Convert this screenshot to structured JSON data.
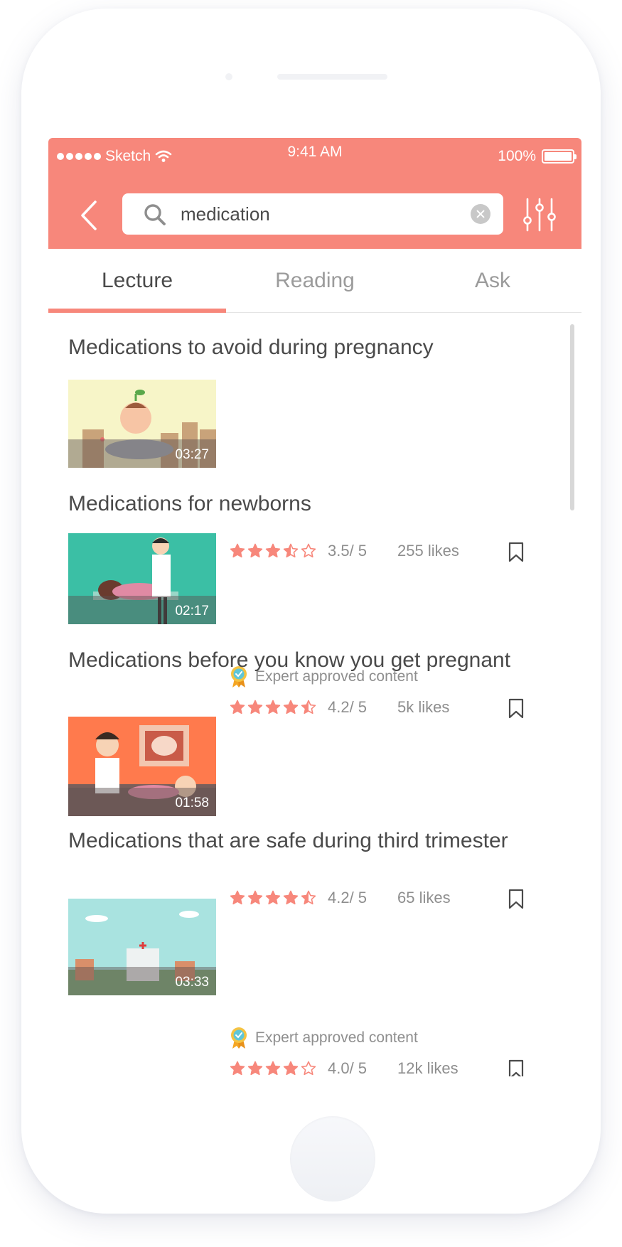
{
  "status_bar": {
    "carrier": "Sketch",
    "time": "9:41 AM",
    "battery": "100%"
  },
  "search": {
    "value": "medication"
  },
  "tabs": [
    {
      "label": "Lecture",
      "active": true
    },
    {
      "label": "Reading",
      "active": false
    },
    {
      "label": "Ask",
      "active": false
    }
  ],
  "colors": {
    "accent": "#f7877b",
    "text": "#4a4a4a",
    "muted": "#8e8e8e"
  },
  "results": [
    {
      "title": "Medications to avoid during pregnancy",
      "duration": "03:27",
      "rating_stars": 3.5,
      "rating": "3.5/ 5",
      "likes": "255 likes",
      "expert": ""
    },
    {
      "title": "Medications for newborns",
      "duration": "02:17",
      "rating_stars": 4.5,
      "rating": "4.2/ 5",
      "likes": "5k likes",
      "expert": "Expert approved content"
    },
    {
      "title": "Medications before you know you get pregnant",
      "duration": "01:58",
      "rating_stars": 4.5,
      "rating": "4.2/ 5",
      "likes": "65 likes",
      "expert": ""
    },
    {
      "title": "Medications that are safe during third trimester",
      "duration": "03:33",
      "rating_stars": 4,
      "rating": "4.0/ 5",
      "likes": "12k likes",
      "expert": "Expert approved content"
    }
  ]
}
